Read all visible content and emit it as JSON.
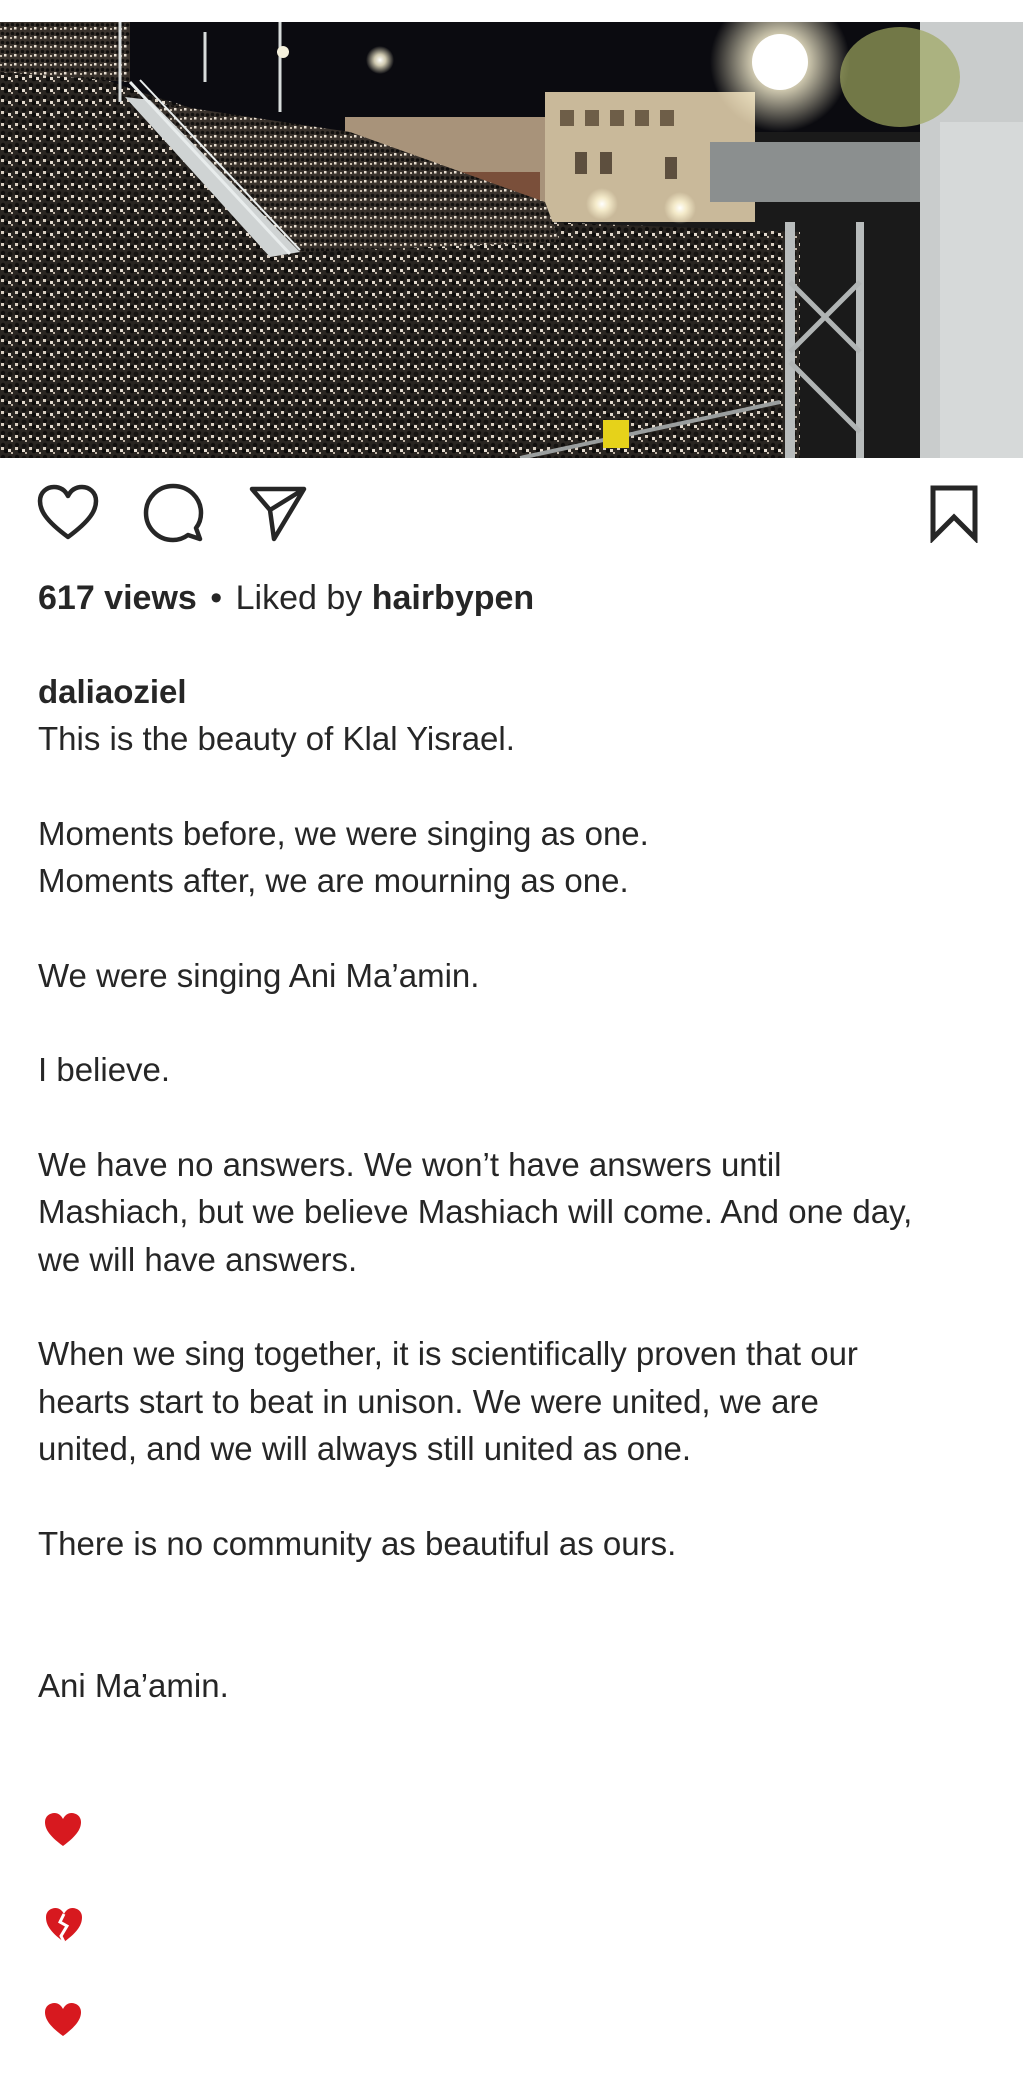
{
  "post": {
    "views_count": "617 views",
    "separator": "•",
    "liked_by_prefix": "Liked by",
    "liked_by_user": "hairbypen",
    "author": "daliaoziel",
    "caption_first_line": "This is the beauty of Klal Yisrael.",
    "paragraphs": [
      "Moments before, we were singing as one.\nMoments after, we are mourning as one.",
      "We were singing Ani Ma’amin.",
      "I believe.",
      "We have no answers. We won’t have answers until\nMashiach, but we believe Mashiach will come. And one day,\nwe will have answers.",
      "When we sing together, it is scientifically proven that our\nhearts start to beat in unison. We were united, we are\nunited, and we will always still united as one.",
      "There is no community as beautiful as ours."
    ],
    "closing_text": "Ani Ma’amin.",
    "closing_emoji": [
      "red-heart",
      "broken-heart",
      "red-heart"
    ]
  },
  "icons": {
    "like": "heart-icon",
    "comment": "comment-bubble-icon",
    "share": "paper-plane-icon",
    "save": "bookmark-icon"
  },
  "colors": {
    "text": "#262626",
    "heart_red": "#d7191f"
  }
}
